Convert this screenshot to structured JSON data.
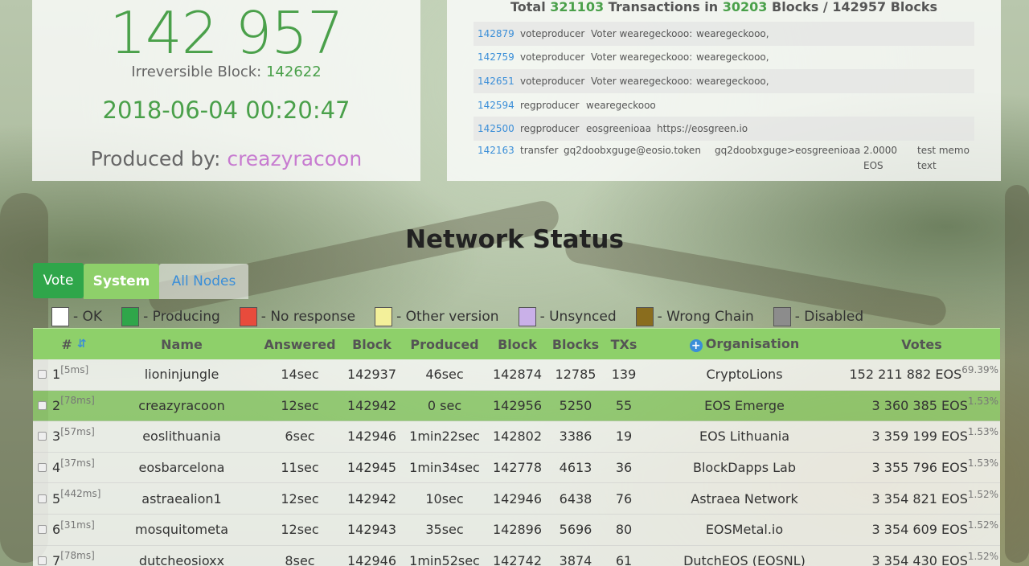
{
  "block_panel": {
    "block_number": "142 957",
    "irreversible_label": "Irreversible Block:",
    "irreversible_value": "142622",
    "timestamp": "2018-06-04 00:20:47",
    "produced_label": "Produced by:",
    "producer": "creazyracoon"
  },
  "tx_panel": {
    "summary_prefix": "Total",
    "tx_count": "321103",
    "summary_mid": "Transactions in",
    "block_count": "30203",
    "summary_suffix": "Blocks / 142957 Blocks",
    "rows": [
      {
        "id": "142879",
        "action": "voteproducer",
        "f1": "Voter wearegeckooo:",
        "f2": "wearegeckooo,"
      },
      {
        "id": "142759",
        "action": "voteproducer",
        "f1": "Voter wearegeckooo:",
        "f2": "wearegeckooo,"
      },
      {
        "id": "142651",
        "action": "voteproducer",
        "f1": "Voter wearegeckooo:",
        "f2": "wearegeckooo,"
      },
      {
        "id": "142594",
        "action": "regproducer",
        "f1": "wearegeckooo",
        "f2": ""
      },
      {
        "id": "142500",
        "action": "regproducer",
        "f1": "eosgreenioaa",
        "f2": "https://eosgreen.io"
      },
      {
        "id": "142163",
        "action": "transfer",
        "f1": "gq2doobxguge@eosio.token",
        "f2": "gq2doobxguge>eosgreenioaa",
        "amount1": "2.0000",
        "amount2": "EOS",
        "memo1": "test memo",
        "memo2": "text"
      }
    ]
  },
  "network": {
    "title": "Network Status",
    "tabs": {
      "vote": "Vote",
      "system": "System",
      "all_nodes": "All Nodes"
    },
    "legend": [
      {
        "label": "- OK",
        "color": "#ffffff"
      },
      {
        "label": "- Producing",
        "color": "#2fa64a"
      },
      {
        "label": "- No response",
        "color": "#e84b3c"
      },
      {
        "label": "- Other version",
        "color": "#f3f09a"
      },
      {
        "label": "- Unsynced",
        "color": "#c9b0e8"
      },
      {
        "label": "- Wrong Chain",
        "color": "#8a6d1e"
      },
      {
        "label": "- Disabled",
        "color": "#8c8c8c"
      }
    ],
    "headers": {
      "rank": "#",
      "name": "Name",
      "answered": "Answered",
      "block": "Block",
      "produced": "Produced",
      "block2": "Block",
      "blocks": "Blocks",
      "txs": "TXs",
      "organisation": "Organisation",
      "votes": "Votes"
    },
    "rows": [
      {
        "rank": "1",
        "latency": "[5ms]",
        "name": "lioninjungle",
        "answered": "14sec",
        "block": "142937",
        "produced": "46sec",
        "block2": "142874",
        "blocks": "12785",
        "txs": "139",
        "org": "CryptoLions",
        "votes": "152 211 882 EOS",
        "pct": "69.39%"
      },
      {
        "rank": "2",
        "latency": "[78ms]",
        "name": "creazyracoon",
        "answered": "12sec",
        "block": "142942",
        "produced": "0 sec",
        "block2": "142956",
        "blocks": "5250",
        "txs": "55",
        "org": "EOS Emerge",
        "votes": "3 360 385 EOS",
        "pct": "1.53%"
      },
      {
        "rank": "3",
        "latency": "[57ms]",
        "name": "eoslithuania",
        "answered": "6sec",
        "block": "142946",
        "produced": "1min22sec",
        "block2": "142802",
        "blocks": "3386",
        "txs": "19",
        "org": "EOS Lithuania",
        "votes": "3 359 199 EOS",
        "pct": "1.53%"
      },
      {
        "rank": "4",
        "latency": "[37ms]",
        "name": "eosbarcelona",
        "answered": "11sec",
        "block": "142945",
        "produced": "1min34sec",
        "block2": "142778",
        "blocks": "4613",
        "txs": "36",
        "org": "BlockDapps Lab",
        "votes": "3 355 796 EOS",
        "pct": "1.53%"
      },
      {
        "rank": "5",
        "latency": "[442ms]",
        "name": "astraealion1",
        "answered": "12sec",
        "block": "142942",
        "produced": "10sec",
        "block2": "142946",
        "blocks": "6438",
        "txs": "76",
        "org": "Astraea Network",
        "votes": "3 354 821 EOS",
        "pct": "1.52%"
      },
      {
        "rank": "6",
        "latency": "[31ms]",
        "name": "mosquitometa",
        "answered": "12sec",
        "block": "142943",
        "produced": "35sec",
        "block2": "142896",
        "blocks": "5696",
        "txs": "80",
        "org": "EOSMetal.io",
        "votes": "3 354 609 EOS",
        "pct": "1.52%"
      },
      {
        "rank": "7",
        "latency": "[78ms]",
        "name": "dutcheosioxx",
        "answered": "8sec",
        "block": "142946",
        "produced": "1min52sec",
        "block2": "142742",
        "blocks": "3874",
        "txs": "61",
        "org": "DutchEOS (EOSNL)",
        "votes": "3 354 430 EOS",
        "pct": "1.52%"
      }
    ]
  }
}
